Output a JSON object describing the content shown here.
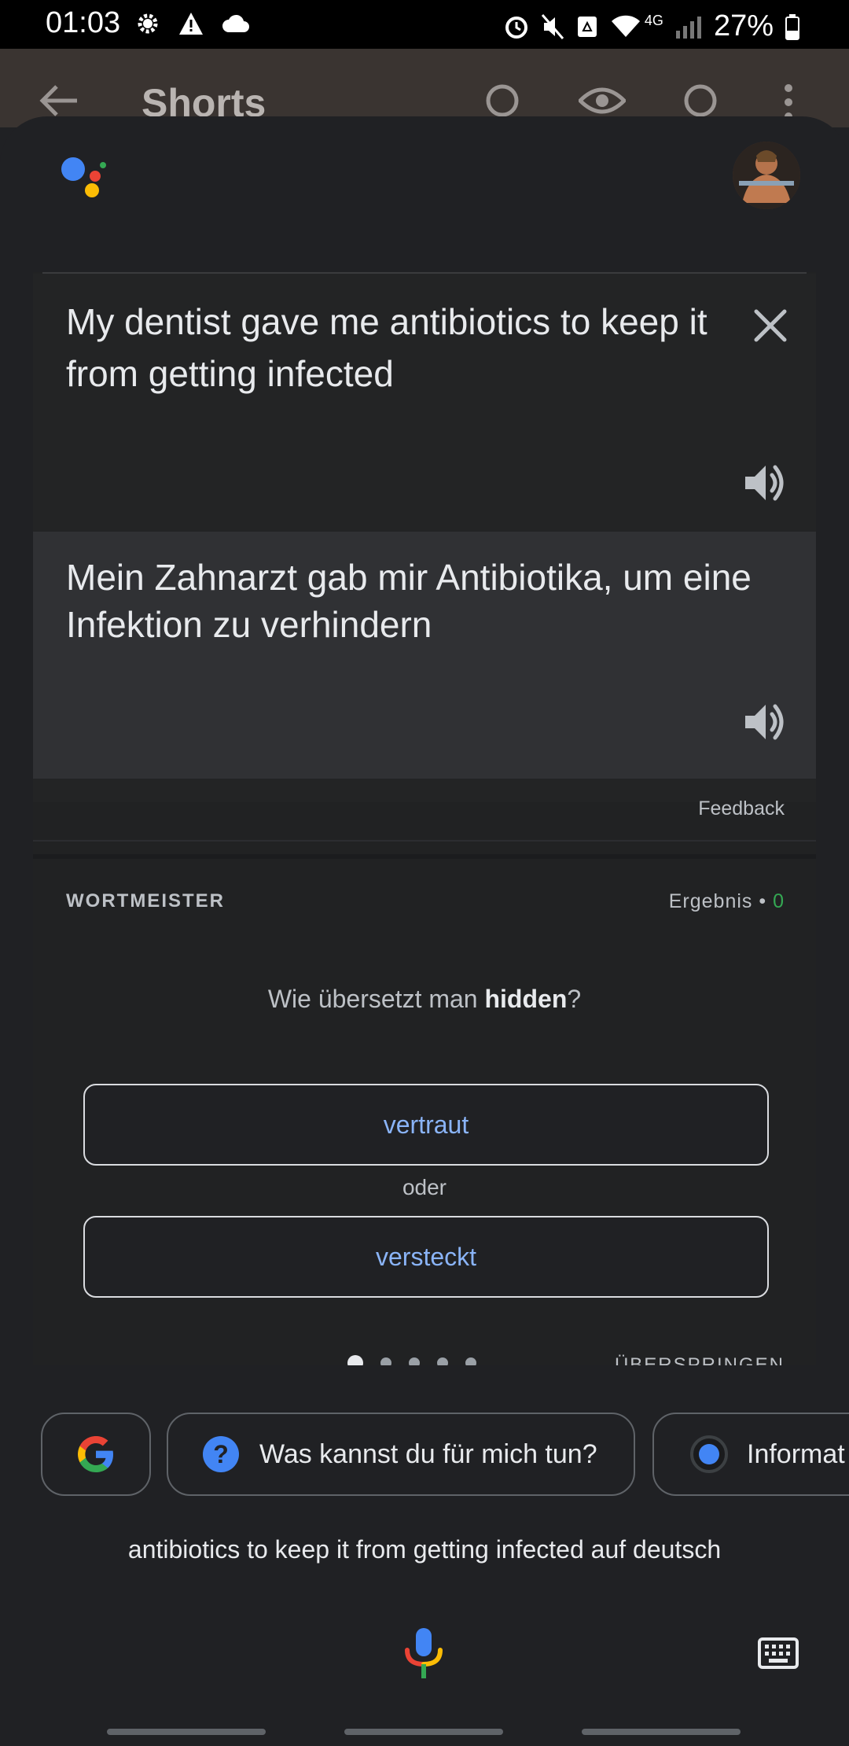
{
  "status_bar": {
    "time": "01:03",
    "battery": "27%",
    "network": "4G"
  },
  "background_app": {
    "title": "Shorts"
  },
  "translation": {
    "source_text": "My dentist gave me antibiotics to keep it from getting infected",
    "target_text": "Mein Zahnarzt gab mir Antibiotika, um eine Infektion zu verhindern",
    "feedback_label": "Feedback"
  },
  "wortmeister": {
    "title": "WORTMEISTER",
    "score_label": "Ergebnis",
    "score_separator": "•",
    "score_value": "0",
    "question_prefix": "Wie übersetzt man ",
    "question_word": "hidden",
    "question_suffix": "?",
    "option_1": "vertraut",
    "separator": "oder",
    "option_2": "versteckt",
    "skip_label": "ÜBERSPRINGEN"
  },
  "chips": {
    "help_label": "Was kannst du für mich tun?",
    "info_label": "Informat"
  },
  "query": {
    "text": "antibiotics to keep it from getting infected auf deutsch"
  },
  "colors": {
    "accent_blue": "#8ab4f8",
    "score_green": "#34a853",
    "google_blue": "#4285f4",
    "google_red": "#ea4335",
    "google_yellow": "#fbbc05",
    "google_green": "#34a853"
  }
}
